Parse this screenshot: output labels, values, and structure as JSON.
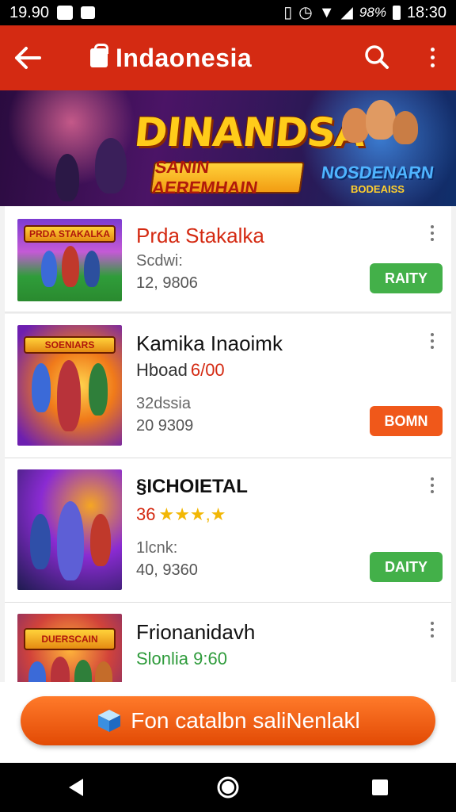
{
  "status_bar": {
    "time_left": "19.90",
    "battery": "98%",
    "time_right": "18:30"
  },
  "app_bar": {
    "title": "Indaonesia",
    "back_icon": "arrow-left-icon",
    "search_icon": "search-icon",
    "more_icon": "more-vert-icon",
    "bag_icon": "shopping-bag-icon"
  },
  "banner": {
    "title": "DINANDSA",
    "subtitle": "SANIN AEREMHAIN",
    "badge_line1": "NOSDENARN",
    "badge_line2": "BODEAISS"
  },
  "items": [
    {
      "thumb_label": "PRDA STAKALKA",
      "title": "Prda Stakalka",
      "meta": "",
      "rating_text": "",
      "label": "Scdwi:",
      "count": "12, 9806",
      "button": "RAITY",
      "button_color": "#43b049",
      "title_color": "#d42a12"
    },
    {
      "thumb_label": "SOENIARS",
      "title": "Kamika Inaoimk",
      "meta_prefix": "Hboad",
      "meta_value": "6/00",
      "label": "32dssia",
      "count": "20 9309",
      "button": "BOMN",
      "button_color": "#f0581a",
      "title_color": "#111111"
    },
    {
      "thumb_label": "",
      "title": "§ICHOIETAL",
      "meta_value": "36",
      "stars": "★★★,★",
      "label": "1lcnk:",
      "count": "40, 9360",
      "button": "DAITY",
      "button_color": "#43b049",
      "title_color": "#111111"
    },
    {
      "thumb_label": "DUERSCAIN",
      "title": "Frionanidavh",
      "meta_value": "Slonlia 9:60",
      "meta_color": "#2e9b3b",
      "label": "",
      "count": "",
      "button": "",
      "button_color": "",
      "title_color": "#111111"
    }
  ],
  "cta": {
    "label": "Fon catalbn saliNenlakl",
    "icon": "cube-icon"
  },
  "nav_bar": {
    "back_icon": "nav-back-icon",
    "home_icon": "nav-home-icon",
    "recents_icon": "nav-recents-icon"
  },
  "colors": {
    "app_bar": "#d42a12",
    "accent_orange": "#f0581a",
    "accent_green": "#43b049"
  }
}
